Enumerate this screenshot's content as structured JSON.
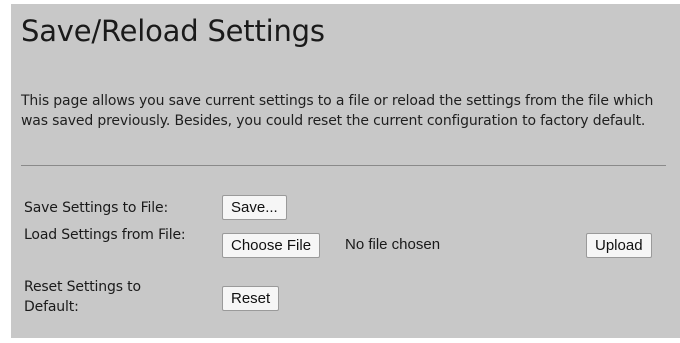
{
  "page": {
    "title": "Save/Reload Settings",
    "description": "This page allows you save current settings to a file or reload the settings from the file which was saved previously. Besides, you could reset the current configuration to factory default."
  },
  "save_row": {
    "label": "Save Settings to File:",
    "button_label": "Save..."
  },
  "load_row": {
    "label": "Load Settings from File:",
    "choose_button_label": "Choose File",
    "file_status": "No file chosen",
    "upload_button_label": "Upload"
  },
  "reset_row": {
    "label": "Reset Settings to Default:",
    "button_label": "Reset"
  }
}
